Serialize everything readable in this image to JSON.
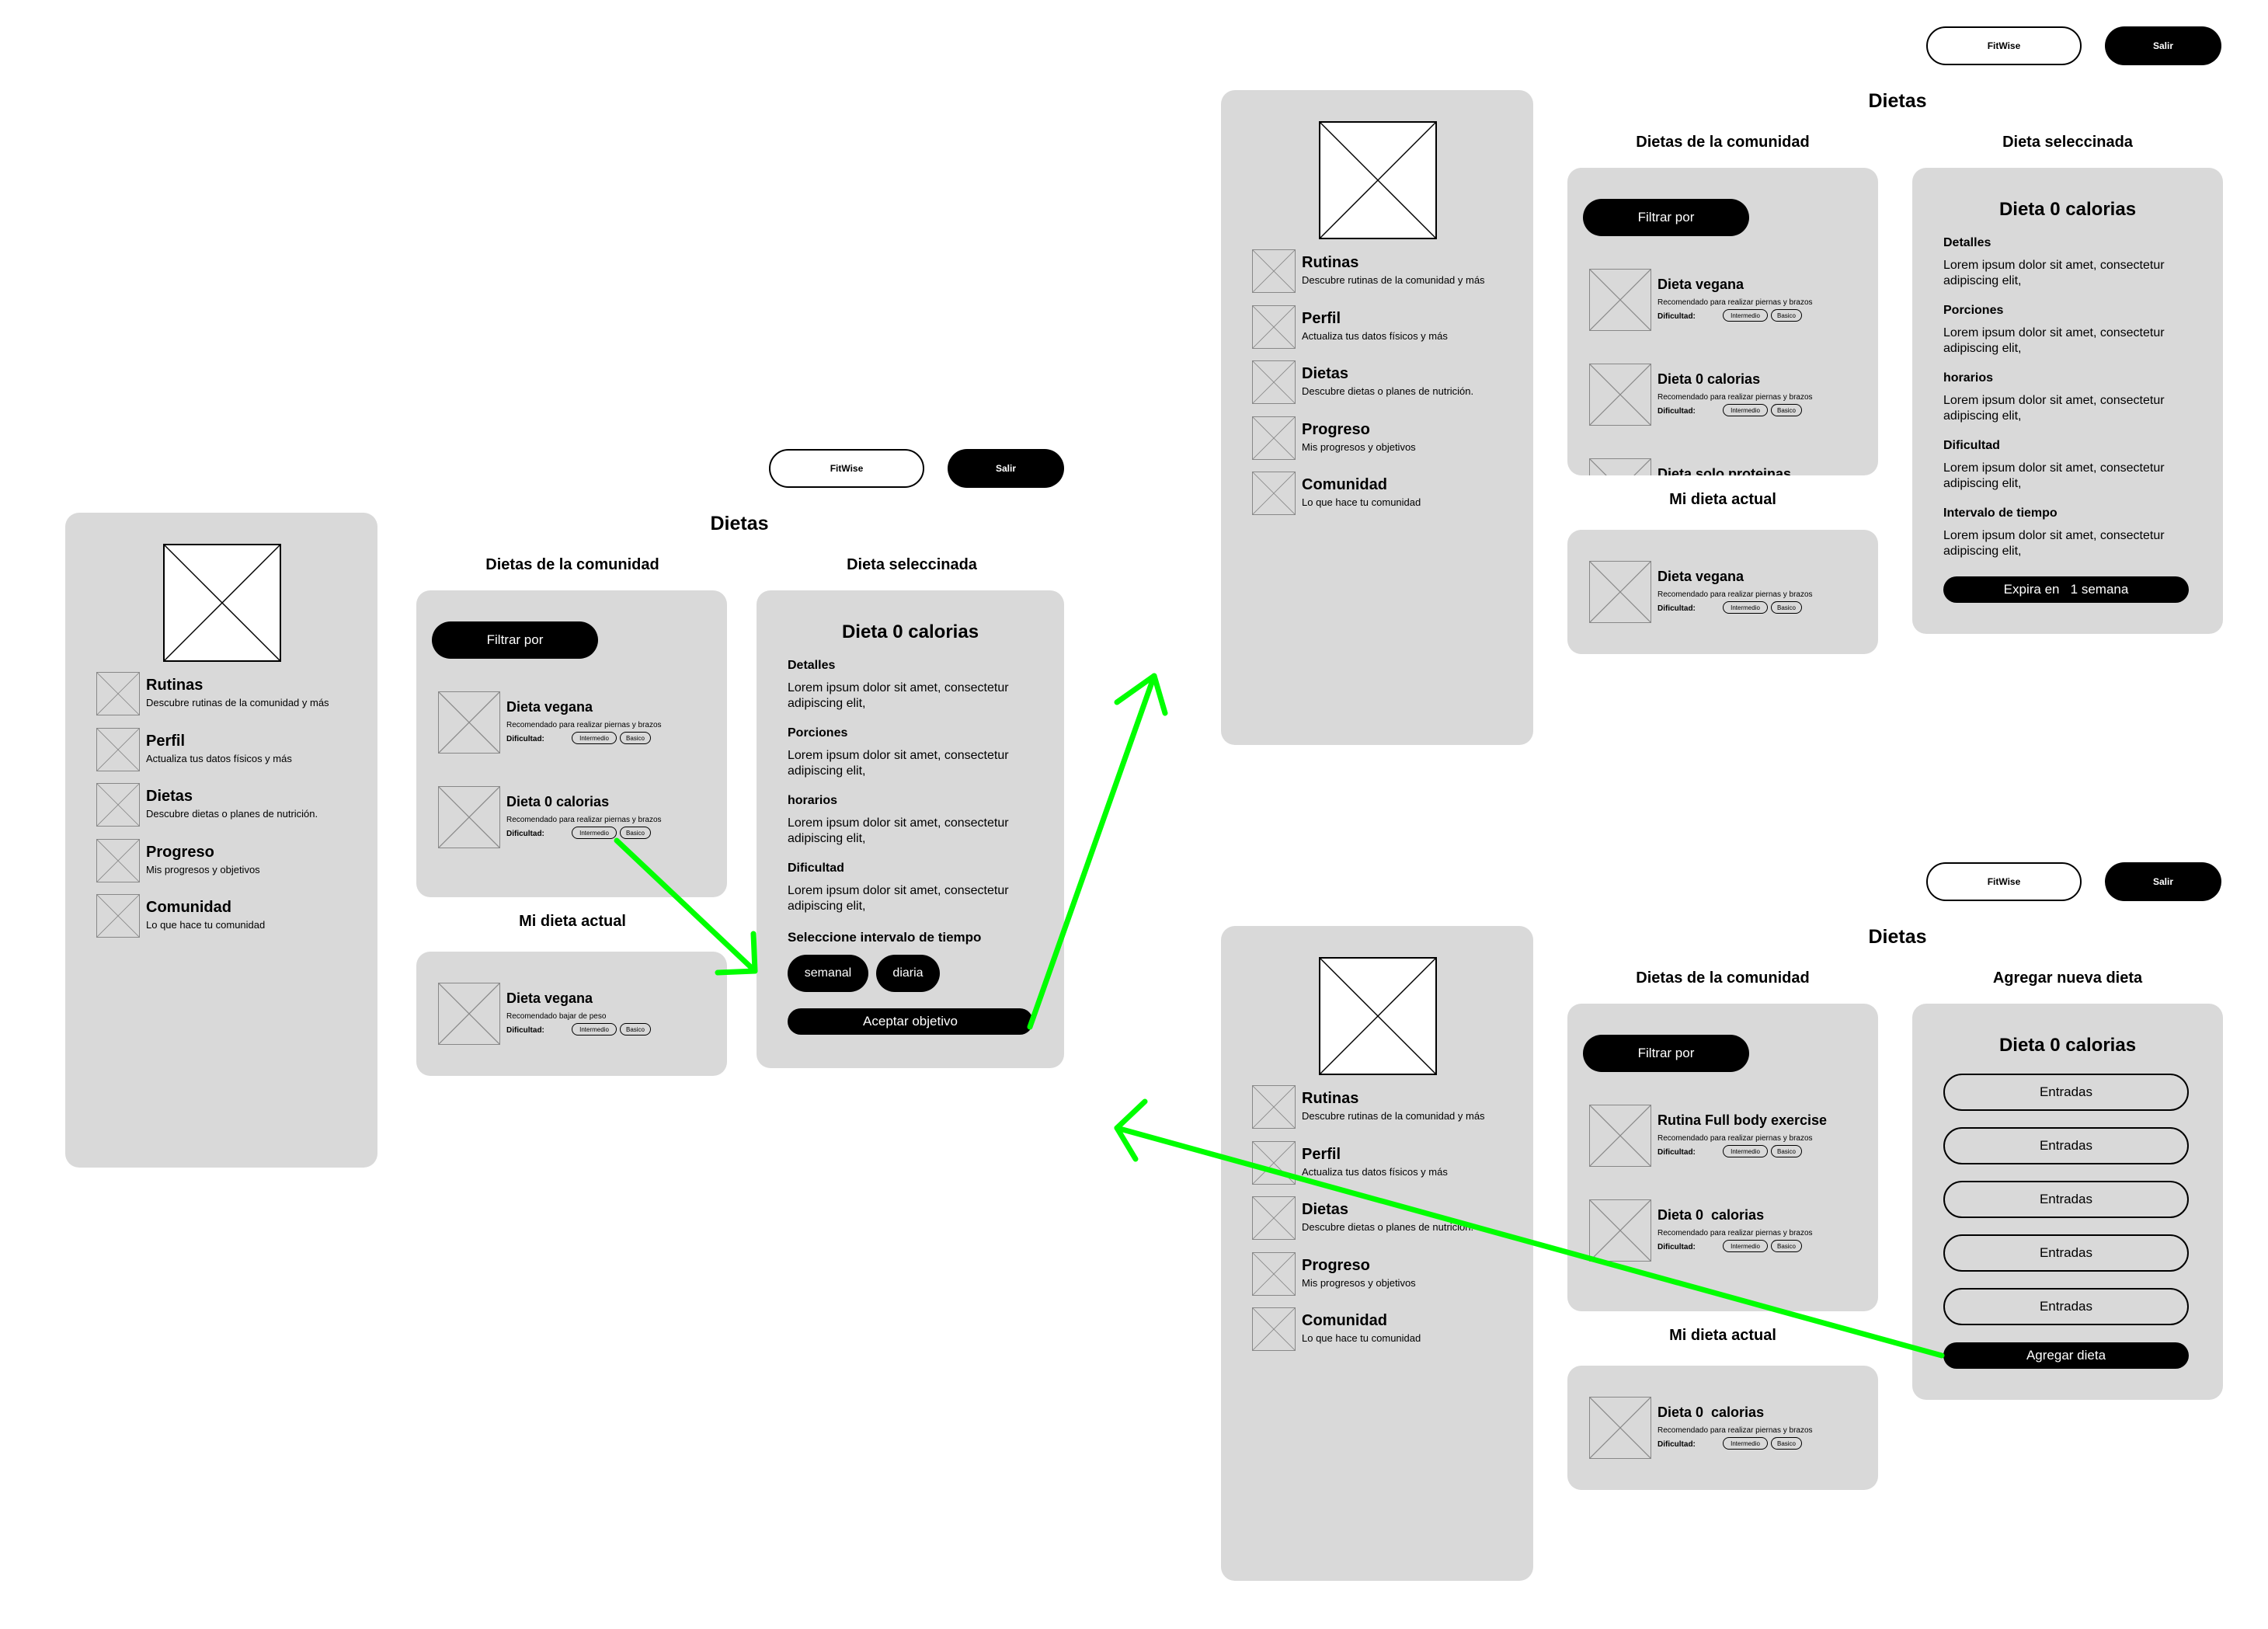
{
  "header": {
    "brand": "FitWise",
    "logout": "Salir"
  },
  "page_title": "Dietas",
  "nav": [
    {
      "label": "Rutinas",
      "desc": "Descubre rutinas de la comunidad y más"
    },
    {
      "label": "Perfil",
      "desc": "Actualiza tus datos físicos y más"
    },
    {
      "label": "Dietas",
      "desc": "Descubre dietas o planes de nutrición."
    },
    {
      "label": "Progreso",
      "desc": "Mis progresos y objetivos"
    },
    {
      "label": "Comunidad",
      "desc": "Lo que hace tu comunidad"
    }
  ],
  "community": {
    "heading": "Dietas  de la comunidad",
    "filter": "Filtrar por"
  },
  "current": {
    "heading": "Mi dieta actual"
  },
  "difficulty_label": "Dificultad:",
  "tags": [
    "Intermedio",
    "Basico"
  ],
  "screen1": {
    "community_items": [
      {
        "name": "Dieta vegana",
        "desc": "Recomendado para realizar piernas y brazos"
      },
      {
        "name": "Dieta 0 calorias",
        "desc": "Recomendado para realizar piernas y brazos"
      }
    ],
    "current_item": {
      "name": "Dieta  vegana",
      "desc": "Recomendado bajar de peso"
    },
    "selected": {
      "heading": "Dieta seleccinada",
      "title": "Dieta 0 calorias",
      "sections": [
        {
          "head": "Detalles",
          "body1": "Lorem ipsum dolor sit amet, consectetur",
          "body2": "adipiscing elit,"
        },
        {
          "head": "Porciones",
          "body1": "Lorem ipsum dolor sit amet, consectetur",
          "body2": "adipiscing elit,"
        },
        {
          "head": "horarios",
          "body1": "Lorem ipsum dolor sit amet, consectetur",
          "body2": "adipiscing elit,"
        },
        {
          "head": "Dificultad",
          "body1": "Lorem ipsum dolor sit amet, consectetur",
          "body2": "adipiscing elit,"
        }
      ],
      "interval_label": "Seleccione intervalo de tiempo",
      "interval_options": [
        "semanal",
        "diaria"
      ],
      "accept": "Aceptar objetivo"
    }
  },
  "screen2": {
    "community_items": [
      {
        "name": "Dieta vegana",
        "desc": "Recomendado para realizar piernas y brazos"
      },
      {
        "name": "Dieta 0 calorias",
        "desc": "Recomendado para realizar piernas y brazos"
      },
      {
        "name": "Dieta solo proteinas"
      }
    ],
    "current_item": {
      "name": "Dieta vegana",
      "desc": "Recomendado para realizar piernas y brazos"
    },
    "selected": {
      "heading": "Dieta seleccinada",
      "title": "Dieta 0 calorias",
      "sections": [
        {
          "head": "Detalles",
          "body1": "Lorem ipsum dolor sit amet, consectetur",
          "body2": "adipiscing elit,"
        },
        {
          "head": "Porciones",
          "body1": "Lorem ipsum dolor sit amet, consectetur",
          "body2": "adipiscing elit,"
        },
        {
          "head": "horarios",
          "body1": "Lorem ipsum dolor sit amet, consectetur",
          "body2": "adipiscing elit,"
        },
        {
          "head": "Dificultad",
          "body1": "Lorem ipsum dolor sit amet, consectetur",
          "body2": "adipiscing elit,"
        },
        {
          "head": "Intervalo de tiempo",
          "body1": "Lorem ipsum dolor sit amet, consectetur",
          "body2": "adipiscing elit,"
        }
      ],
      "expires": "Expira en   1 semana"
    }
  },
  "screen3": {
    "community_items": [
      {
        "name": "Rutina Full body exercise",
        "desc": "Recomendado para realizar piernas y brazos"
      },
      {
        "name": "Dieta 0  calorias",
        "desc": "Recomendado para realizar piernas y brazos"
      }
    ],
    "current_item": {
      "name": "Dieta 0  calorias",
      "desc": "Recomendado para realizar piernas y brazos"
    },
    "add": {
      "heading": "Agregar nueva dieta",
      "title": "Dieta 0 calorias",
      "entries": [
        "Entradas",
        "Entradas",
        "Entradas",
        "Entradas",
        "Entradas"
      ],
      "button": "Agregar dieta"
    }
  },
  "colors": {
    "panel": "#d9d9d9",
    "arrow": "#00ff00",
    "button": "#000000"
  }
}
